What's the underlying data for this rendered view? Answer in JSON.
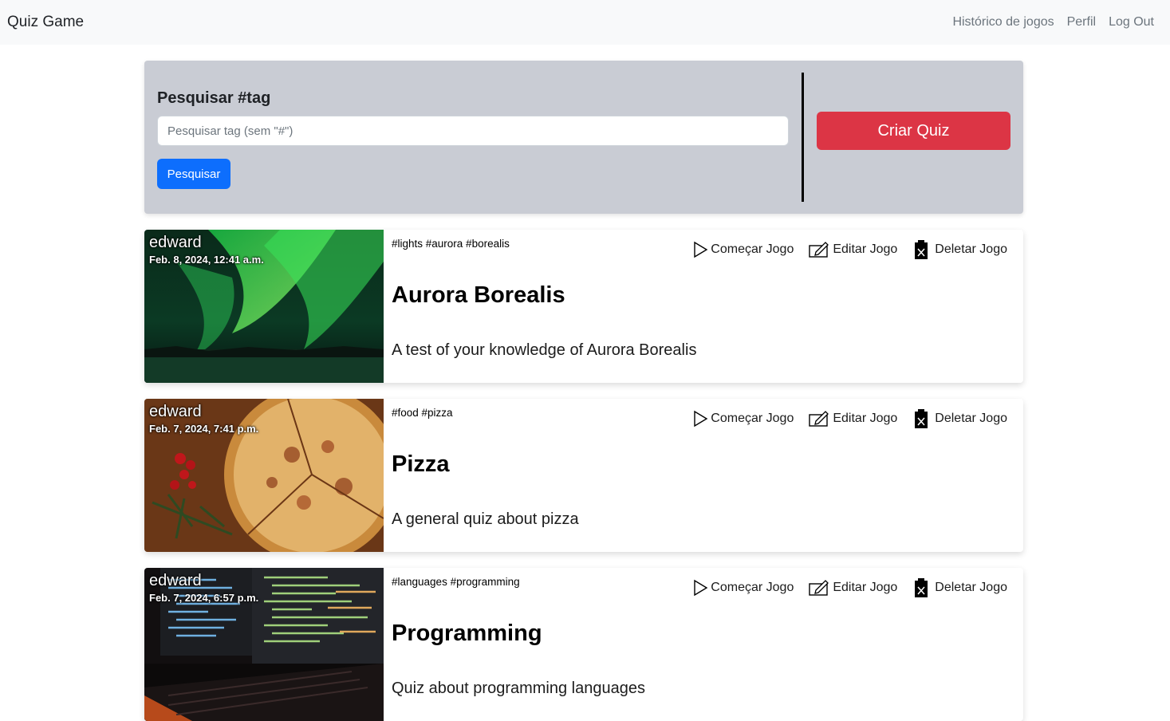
{
  "navbar": {
    "brand": "Quiz Game",
    "links": [
      "Histórico de jogos",
      "Perfil",
      "Log Out"
    ]
  },
  "search": {
    "title": "Pesquisar #tag",
    "placeholder": "Pesquisar tag (sem \"#\")",
    "button_label": "Pesquisar",
    "create_label": "Criar Quiz"
  },
  "actions": {
    "start": "Começar Jogo",
    "edit": "Editar Jogo",
    "delete": "Deletar Jogo"
  },
  "quizzes": [
    {
      "author": "edward",
      "date": "Feb. 8, 2024, 12:41 a.m.",
      "tags": "#lights #aurora #borealis",
      "title": "Aurora Borealis",
      "description": "A test of your knowledge of Aurora Borealis",
      "image": "aurora-photo"
    },
    {
      "author": "edward",
      "date": "Feb. 7, 2024, 7:41 p.m.",
      "tags": "#food #pizza",
      "title": "Pizza",
      "description": "A general quiz about pizza",
      "image": "pizza-photo"
    },
    {
      "author": "edward",
      "date": "Feb. 7, 2024, 6:57 p.m.",
      "tags": "#languages #programming",
      "title": "Programming",
      "description": "Quiz about programming languages",
      "image": "code-screen-photo"
    }
  ],
  "colors": {
    "navbar_bg": "#f8f9fa",
    "panel_bg": "#c9ccd4",
    "primary": "#0d6efd",
    "danger": "#dc3545"
  }
}
